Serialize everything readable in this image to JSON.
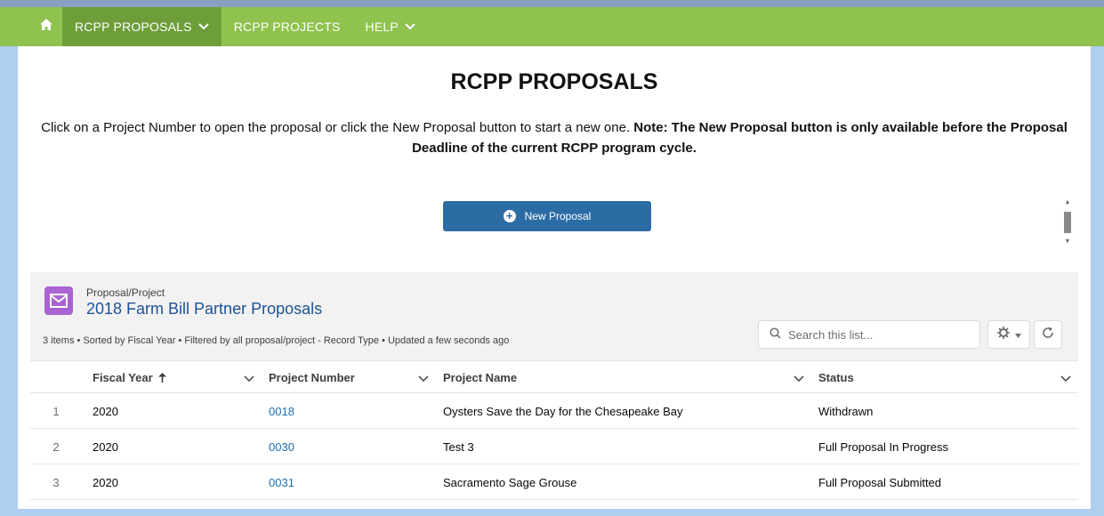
{
  "nav": {
    "items": [
      {
        "label": "RCPP PROPOSALS",
        "active": true,
        "dropdown": true
      },
      {
        "label": "RCPP PROJECTS",
        "active": false,
        "dropdown": false
      },
      {
        "label": "HELP",
        "active": false,
        "dropdown": true
      }
    ],
    "home_icon": "home-icon",
    "bar_color": "#8fc24f",
    "active_color": "#6e9e3a"
  },
  "page": {
    "title": "RCPP PROPOSALS",
    "intro_plain": "Click on a Project Number to open the proposal or click the New Proposal button to start a new one. ",
    "intro_bold": "Note: The New Proposal button is only available before the Proposal Deadline of the current RCPP program cycle.",
    "new_button_label": "New Proposal",
    "accent": "#2c6ca5"
  },
  "listview": {
    "object_label": "Proposal/Project",
    "title": "2018 Farm Bill Partner Proposals",
    "meta": "3 items • Sorted by Fiscal Year • Filtered by all proposal/project - Record Type • Updated a few seconds ago",
    "search_placeholder": "Search this list...",
    "icon_color": "#a963d3",
    "columns": [
      {
        "label": "Fiscal Year",
        "sort_icon": "arrow-up-icon"
      },
      {
        "label": "Project Number"
      },
      {
        "label": "Project Name"
      },
      {
        "label": "Status"
      }
    ],
    "rows": [
      {
        "num": "1",
        "fiscal_year": "2020",
        "project_number": "0018",
        "project_name": "Oysters Save the Day for the Chesapeake Bay",
        "status": "Withdrawn"
      },
      {
        "num": "2",
        "fiscal_year": "2020",
        "project_number": "0030",
        "project_name": "Test 3",
        "status": "Full Proposal In Progress"
      },
      {
        "num": "3",
        "fiscal_year": "2020",
        "project_number": "0031",
        "project_name": "Sacramento Sage Grouse",
        "status": "Full Proposal Submitted"
      }
    ]
  }
}
